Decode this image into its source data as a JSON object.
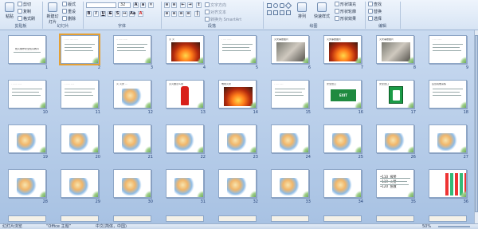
{
  "ribbon": {
    "clipboard": {
      "paste": "粘贴",
      "cut": "剪切",
      "copy": "复制",
      "format_painter": "格式刷",
      "label": "剪贴板"
    },
    "slides": {
      "new_slide": "新建幻灯片",
      "layout": "版式",
      "reset": "重设",
      "delete": "删除",
      "label": "幻灯片"
    },
    "font": {
      "font_name": "",
      "font_size": "32",
      "label": "字体"
    },
    "paragraph": {
      "convert_smartart": "转换为 SmartArt",
      "label": "段落"
    },
    "drawing": {
      "arrange": "排列",
      "quick_styles": "快速样式",
      "shape_fill": "形状填充",
      "shape_outline": "形状轮廓",
      "shape_effects": "形状效果",
      "label": "绘图"
    },
    "editing": {
      "find": "查找",
      "replace": "替换",
      "select": "选择",
      "label": "编辑"
    }
  },
  "slides": [
    {
      "n": "1",
      "kind": "title",
      "text": "燃火爆炸安全知识教育"
    },
    {
      "n": "2",
      "kind": "text",
      "text": "· ····· ····· ·····"
    },
    {
      "n": "3",
      "kind": "text",
      "text": "·· ····· ······"
    },
    {
      "n": "4",
      "kind": "fire",
      "text": "火 火"
    },
    {
      "n": "5",
      "kind": "text",
      "text": "· ···· ······"
    },
    {
      "n": "6",
      "kind": "photo",
      "text": "火灾事故图片"
    },
    {
      "n": "7",
      "kind": "fire",
      "text": "火灾事故图片"
    },
    {
      "n": "8",
      "kind": "photo",
      "text": "火灾事故图片"
    },
    {
      "n": "9",
      "kind": "text",
      "text": "· ···· ······"
    },
    {
      "n": "10",
      "kind": "text",
      "text": "· ······ ·····"
    },
    {
      "n": "11",
      "kind": "text",
      "text": "· ······ ·····"
    },
    {
      "n": "12",
      "kind": "cart",
      "text": "火 火灾 …"
    },
    {
      "n": "13",
      "kind": "ext",
      "text": "灭火器怎么用"
    },
    {
      "n": "14",
      "kind": "fire",
      "text": "电线火灾"
    },
    {
      "n": "15",
      "kind": "text",
      "text": "· ···· ·····"
    },
    {
      "n": "16",
      "kind": "exit",
      "text": "安全出口"
    },
    {
      "n": "17",
      "kind": "exitbox",
      "text": "安全出口"
    },
    {
      "n": "18",
      "kind": "text",
      "text": "应急疏散演练"
    },
    {
      "n": "19",
      "kind": "cart",
      "text": ""
    },
    {
      "n": "20",
      "kind": "cart",
      "text": ""
    },
    {
      "n": "21",
      "kind": "cart",
      "text": ""
    },
    {
      "n": "22",
      "kind": "cart",
      "text": ""
    },
    {
      "n": "23",
      "kind": "cart",
      "text": ""
    },
    {
      "n": "24",
      "kind": "cart",
      "text": ""
    },
    {
      "n": "25",
      "kind": "cart",
      "text": ""
    },
    {
      "n": "26",
      "kind": "cart",
      "text": ""
    },
    {
      "n": "27",
      "kind": "cart",
      "text": ""
    },
    {
      "n": "28",
      "kind": "cart",
      "text": ""
    },
    {
      "n": "29",
      "kind": "cart",
      "text": ""
    },
    {
      "n": "30",
      "kind": "cart",
      "text": ""
    },
    {
      "n": "31",
      "kind": "cart",
      "text": ""
    },
    {
      "n": "32",
      "kind": "cart",
      "text": ""
    },
    {
      "n": "33",
      "kind": "cart",
      "text": ""
    },
    {
      "n": "34",
      "kind": "cart",
      "text": ""
    },
    {
      "n": "35",
      "kind": "phones",
      "text": "•110  报警\n•119  火警\n•120  急救"
    },
    {
      "n": "36",
      "kind": "color",
      "text": ""
    }
  ],
  "status": {
    "left": "幻灯片浏览",
    "theme": "“Office 主题”",
    "lang": "中文(简体，中国)",
    "zoom": "50%"
  }
}
